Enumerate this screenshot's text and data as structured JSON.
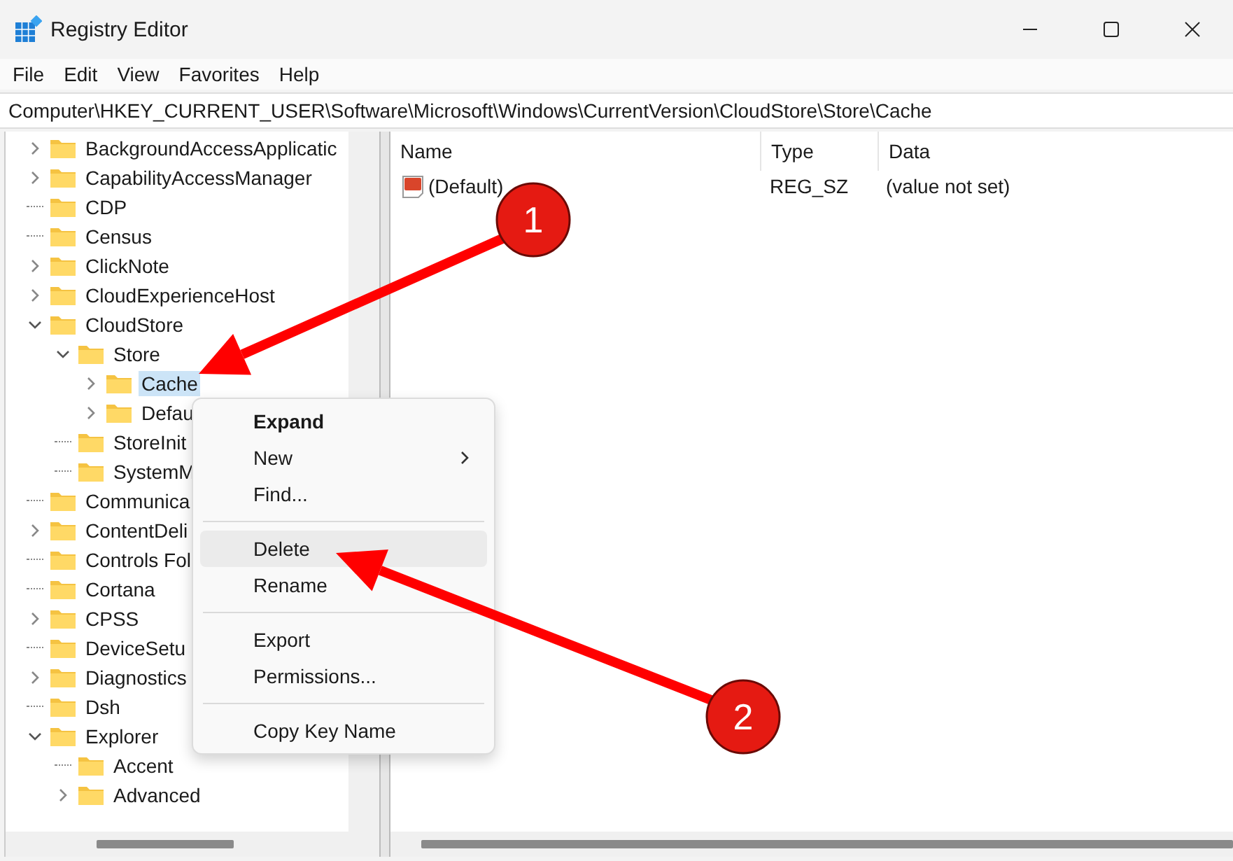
{
  "window": {
    "title": "Registry Editor"
  },
  "menu": [
    "File",
    "Edit",
    "View",
    "Favorites",
    "Help"
  ],
  "address": "Computer\\HKEY_CURRENT_USER\\Software\\Microsoft\\Windows\\CurrentVersion\\CloudStore\\Store\\Cache",
  "tree": [
    {
      "label": "BackgroundAccessApplicatic",
      "expandable": true,
      "expanded": false,
      "selected": false
    },
    {
      "label": "CapabilityAccessManager",
      "expandable": true,
      "expanded": false,
      "selected": false
    },
    {
      "label": "CDP",
      "expandable": false,
      "expanded": false,
      "selected": false
    },
    {
      "label": "Census",
      "expandable": false,
      "expanded": false,
      "selected": false
    },
    {
      "label": "ClickNote",
      "expandable": true,
      "expanded": false,
      "selected": false
    },
    {
      "label": "CloudExperienceHost",
      "expandable": true,
      "expanded": false,
      "selected": false
    },
    {
      "label": "CloudStore",
      "expandable": true,
      "expanded": true,
      "selected": false,
      "children": [
        {
          "label": "Store",
          "expandable": true,
          "expanded": true,
          "selected": false,
          "children": [
            {
              "label": "Cache",
              "expandable": true,
              "expanded": false,
              "selected": true
            },
            {
              "label": "Defau",
              "expandable": true,
              "expanded": false,
              "selected": false
            }
          ]
        },
        {
          "label": "StoreInit",
          "expandable": false,
          "expanded": false,
          "selected": false
        },
        {
          "label": "SystemM",
          "expandable": false,
          "expanded": false,
          "selected": false
        }
      ]
    },
    {
      "label": "Communica",
      "expandable": false,
      "expanded": false,
      "selected": false
    },
    {
      "label": "ContentDeli",
      "expandable": true,
      "expanded": false,
      "selected": false
    },
    {
      "label": "Controls Fol",
      "expandable": false,
      "expanded": false,
      "selected": false
    },
    {
      "label": "Cortana",
      "expandable": false,
      "expanded": false,
      "selected": false
    },
    {
      "label": "CPSS",
      "expandable": true,
      "expanded": false,
      "selected": false
    },
    {
      "label": "DeviceSetu",
      "expandable": false,
      "expanded": false,
      "selected": false
    },
    {
      "label": "Diagnostics",
      "expandable": true,
      "expanded": false,
      "selected": false
    },
    {
      "label": "Dsh",
      "expandable": false,
      "expanded": false,
      "selected": false
    },
    {
      "label": "Explorer",
      "expandable": true,
      "expanded": true,
      "selected": false,
      "children": [
        {
          "label": "Accent",
          "expandable": false,
          "expanded": false,
          "selected": false
        },
        {
          "label": "Advanced",
          "expandable": true,
          "expanded": false,
          "selected": false
        }
      ]
    }
  ],
  "values": {
    "columns": [
      "Name",
      "Type",
      "Data"
    ],
    "rows": [
      {
        "name": "(Default)",
        "type": "REG_SZ",
        "data": "(value not set)"
      }
    ]
  },
  "context_menu": [
    {
      "kind": "item",
      "label": "Expand",
      "default": true,
      "submenu": false,
      "selected": false
    },
    {
      "kind": "item",
      "label": "New",
      "default": false,
      "submenu": true,
      "selected": false
    },
    {
      "kind": "item",
      "label": "Find...",
      "default": false,
      "submenu": false,
      "selected": false
    },
    {
      "kind": "separator"
    },
    {
      "kind": "item",
      "label": "Delete",
      "default": false,
      "submenu": false,
      "selected": true
    },
    {
      "kind": "item",
      "label": "Rename",
      "default": false,
      "submenu": false,
      "selected": false
    },
    {
      "kind": "separator"
    },
    {
      "kind": "item",
      "label": "Export",
      "default": false,
      "submenu": false,
      "selected": false
    },
    {
      "kind": "item",
      "label": "Permissions...",
      "default": false,
      "submenu": false,
      "selected": false
    },
    {
      "kind": "separator"
    },
    {
      "kind": "item",
      "label": "Copy Key Name",
      "default": false,
      "submenu": false,
      "selected": false
    }
  ],
  "callouts": [
    {
      "label": "1"
    },
    {
      "label": "2"
    }
  ]
}
